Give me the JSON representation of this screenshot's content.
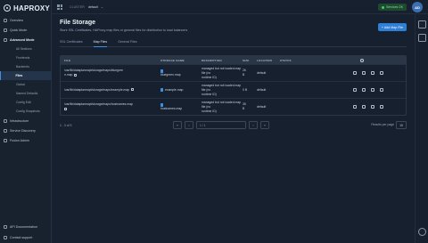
{
  "brand": {
    "name": "HAPROXY"
  },
  "sidebar": {
    "items": [
      {
        "label": "Overview"
      },
      {
        "label": "Quick Mode"
      },
      {
        "label": "Advanced Mode"
      }
    ],
    "subitems": [
      {
        "label": "All Sections"
      },
      {
        "label": "Frontends"
      },
      {
        "label": "Backends"
      },
      {
        "label": "Files"
      },
      {
        "label": "Global"
      },
      {
        "label": "Named Defaults"
      },
      {
        "label": "Config Edit"
      },
      {
        "label": "Config Snapshots"
      }
    ],
    "lower_items": [
      {
        "label": "Infrastructure"
      },
      {
        "label": "Service Discovery"
      },
      {
        "label": "Fusion Admin"
      }
    ],
    "bottom_items": [
      {
        "label": "API Documentation"
      },
      {
        "label": "Contact support"
      }
    ]
  },
  "topbar": {
    "cluster_label": "CLUSTER",
    "cluster_value": "default",
    "status_label": "Services OK",
    "avatar_initials": "AD"
  },
  "main": {
    "title": "File Storage",
    "description": "Store SSL Certificates, HAProxy map files or general files for distribution to load balancers",
    "add_button": "+ Add Map File",
    "tabs": [
      {
        "label": "SSL Certificates"
      },
      {
        "label": "Map Files"
      },
      {
        "label": "General Files"
      }
    ],
    "columns": [
      "FILE",
      "STORAGE NAME",
      "DESCRIPTION",
      "SIZE",
      "LOCATION",
      "STATUS"
    ],
    "rows": [
      {
        "path1": "/var/lib/dataplaneapi/storage/maps/bluegree",
        "path2": "n.map",
        "name": "bluegreen.map",
        "desc1": "managed but not loaded map file (no",
        "desc2": "runtime ID)",
        "size1": "26",
        "size2": "B",
        "location": "default"
      },
      {
        "path1": "/var/lib/dataplaneapi/storage/maps/example.map",
        "path2": "",
        "name": "example.map",
        "desc1": "managed but not loaded map file (no",
        "desc2": "runtime ID)",
        "size1": "0 B",
        "size2": "",
        "location": "default"
      },
      {
        "path1": "/var/lib/dataplaneapi/storage/maps/hostnames.map",
        "path2": "",
        "name": "hostnames.map",
        "desc1": "managed but not loaded map file (no",
        "desc2": "runtime ID)",
        "size1": "35",
        "size2": "B",
        "location": "default"
      }
    ],
    "range_text": "1 - 3 of 3",
    "page_input": "1 / 1",
    "rows_per_page_label": "Results per page",
    "rows_per_page_value": "10"
  },
  "colors": {
    "accent": "#3e8fe3",
    "background": "#16202f",
    "success": "#3ccf6e"
  }
}
